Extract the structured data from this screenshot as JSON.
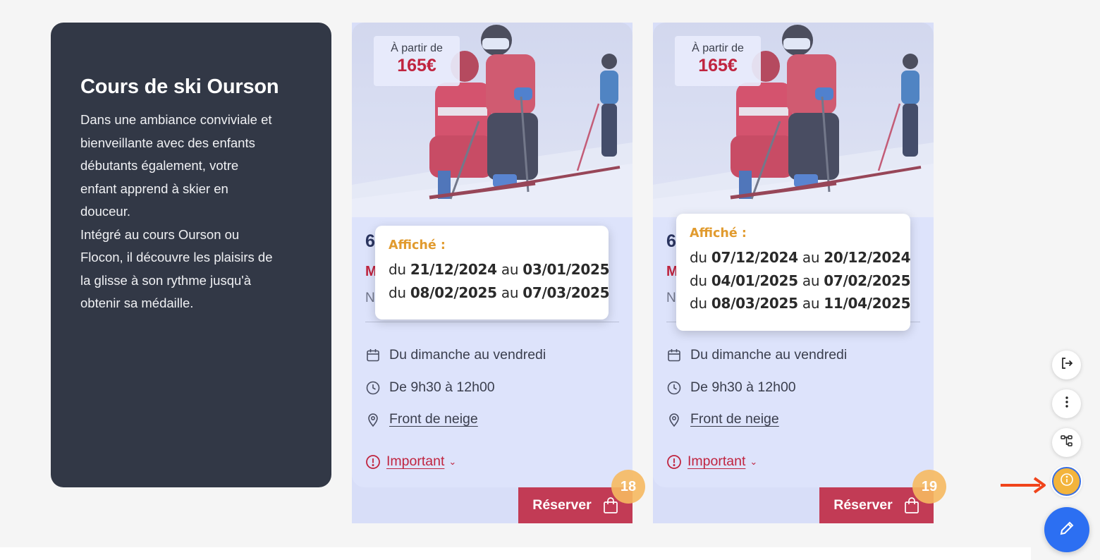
{
  "intro": {
    "title": "Cours de ski Ourson",
    "description_lines": [
      "Dans une ambiance conviviale et",
      "bienveillante avec des enfants",
      "débutants également, votre",
      "enfant apprend à skier en",
      "douceur.",
      "Intégré au cours Ourson ou",
      "Flocon, il découvre les plaisirs de",
      "la glisse à son rythme jusqu'à",
      "obtenir sa médaille."
    ]
  },
  "offers": [
    {
      "price_label": "À partir de",
      "price": "165€",
      "covered_line1": "6",
      "covered_line2": "M",
      "covered_line3": "N",
      "days": "Du dimanche au vendredi",
      "hours": "De 9h30 à 12h00",
      "location": "Front de neige",
      "important": "Important",
      "book_label": "Réserver",
      "badge": "18",
      "popover": {
        "title": "Affiché :",
        "word_from": "du",
        "word_to": "au",
        "ranges": [
          {
            "from": "21/12/2024",
            "to": "03/01/2025"
          },
          {
            "from": "08/02/2025",
            "to": "07/03/2025"
          }
        ]
      }
    },
    {
      "price_label": "À partir de",
      "price": "165€",
      "covered_line1": "6",
      "covered_line2": "M",
      "covered_line3": "N",
      "days": "Du dimanche au vendredi",
      "hours": "De 9h30 à 12h00",
      "location": "Front de neige",
      "important": "Important",
      "book_label": "Réserver",
      "badge": "19",
      "popover": {
        "title": "Affiché :",
        "word_from": "du",
        "word_to": "au",
        "ranges": [
          {
            "from": "07/12/2024",
            "to": "20/12/2024"
          },
          {
            "from": "04/01/2025",
            "to": "07/02/2025"
          },
          {
            "from": "08/03/2025",
            "to": "11/04/2025"
          }
        ]
      }
    }
  ],
  "colors": {
    "intro_bg": "#323846",
    "card_bg": "#dde3fb",
    "accent_red": "#c0243f",
    "button_red": "#c23b55",
    "badge_orange": "#f6b960",
    "popover_title": "#e19b2f",
    "edit_blue": "#2c6ff2",
    "arrow_red": "#f0441b"
  },
  "toolbar": {
    "icons": [
      "logout-icon",
      "more-vertical-icon",
      "sitemap-icon",
      "info-icon",
      "edit-pencil-icon"
    ]
  }
}
